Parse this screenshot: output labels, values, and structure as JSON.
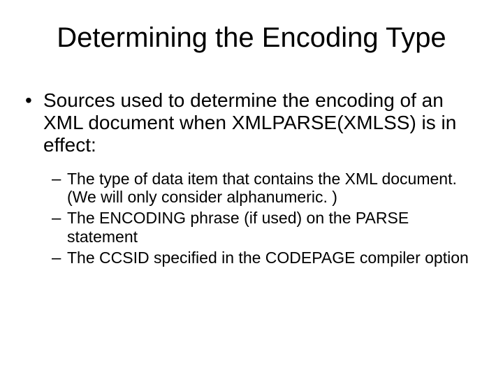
{
  "title": "Determining the Encoding Type",
  "bullets": {
    "l1": "Sources used to determine the encoding of an XML document when XMLPARSE(XMLSS) is in effect:",
    "l2": [
      "The type of data item that contains the XML document. (We will only consider alphanumeric. )",
      "The ENCODING phrase (if used) on the PARSE statement",
      "The CCSID specified in the CODEPAGE compiler option"
    ]
  }
}
